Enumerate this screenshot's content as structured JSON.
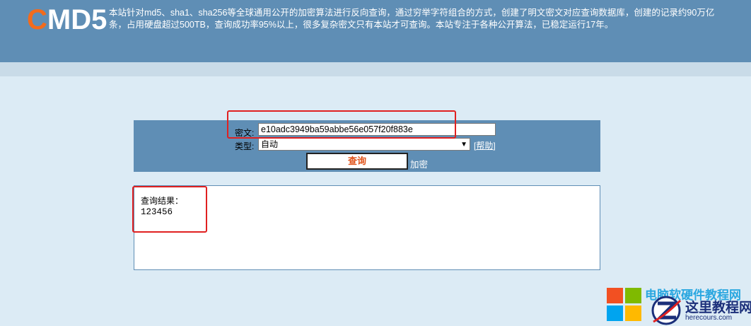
{
  "header": {
    "logo_first": "C",
    "logo_rest": "MD5",
    "intro": "本站针对md5、sha1、sha256等全球通用公开的加密算法进行反向查询，通过穷举字符组合的方式，创建了明文密文对应查询数据库，创建的记录约90万亿条，占用硬盘超过500TB，查询成功率95%以上，很多复杂密文只有本站才可查询。本站专注于各种公开算法，已稳定运行17年。"
  },
  "form": {
    "cipher_label": "密文:",
    "cipher_value": "e10adc3949ba59abbe56e057f20f883e",
    "type_label": "类型:",
    "type_value": "自动",
    "help_link": "帮助",
    "query_button": "查询",
    "encrypt_link": "加密"
  },
  "result": {
    "label": "查询结果：",
    "value": "123456"
  },
  "watermark": {
    "blue_text": "电脑软硬件教程网",
    "main_text": "这里教程网",
    "domain": "herecours.com"
  },
  "colors": {
    "accent": "#5f8eb5",
    "background": "#dcebf5",
    "logo_c": "#f36b1c",
    "query_text": "#e0541b",
    "annotation": "#e02020"
  }
}
